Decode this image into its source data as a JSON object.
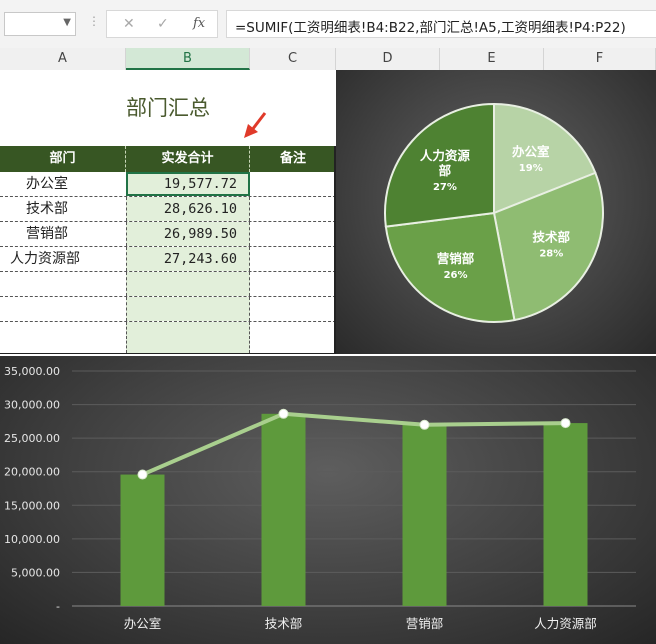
{
  "formula_bar": {
    "name_box_value": "",
    "cancel_icon": "✕",
    "enter_icon": "✓",
    "fx_label": "fx",
    "formula": "=SUMIF(工资明细表!B4:B22,部门汇总!A5,工资明细表!P4:P22)"
  },
  "columns": [
    "A",
    "B",
    "C",
    "D",
    "E",
    "F"
  ],
  "sheet": {
    "title": "部门汇总",
    "headers": [
      "部门",
      "实发合计",
      "备注"
    ],
    "rows": [
      {
        "dept": "办公室",
        "amount": "19,577.72",
        "note": ""
      },
      {
        "dept": "技术部",
        "amount": "28,626.10",
        "note": ""
      },
      {
        "dept": "营销部",
        "amount": "26,989.50",
        "note": ""
      },
      {
        "dept": "人力资源部",
        "amount": "27,243.60",
        "note": ""
      },
      {
        "dept": "",
        "amount": "",
        "note": ""
      },
      {
        "dept": "",
        "amount": "",
        "note": ""
      },
      {
        "dept": "",
        "amount": "",
        "note": ""
      }
    ]
  },
  "pie_chart": {
    "type": "pie",
    "slices": [
      {
        "label": "办公室",
        "pct": "19%",
        "value": 19,
        "color": "#b7d3a6"
      },
      {
        "label": "技术部",
        "pct": "28%",
        "value": 28,
        "color": "#8fbc72"
      },
      {
        "label": "营销部",
        "pct": "26%",
        "value": 26,
        "color": "#6aa048"
      },
      {
        "label": "人力资源部",
        "pct": "27%",
        "value": 27,
        "color": "#4e8232"
      }
    ]
  },
  "chart_data": {
    "type": "bar",
    "categories": [
      "办公室",
      "技术部",
      "营销部",
      "人力资源部"
    ],
    "series": [
      {
        "type": "bar",
        "values": [
          19577.72,
          28626.1,
          26989.5,
          27243.6
        ]
      },
      {
        "type": "line",
        "values": [
          19577.72,
          28626.1,
          26989.5,
          27243.6
        ]
      }
    ],
    "ylim": [
      0,
      35000
    ],
    "yticks": [
      "-",
      "5,000.00",
      "10,000.00",
      "15,000.00",
      "20,000.00",
      "25,000.00",
      "30,000.00",
      "35,000.00"
    ],
    "colors": {
      "bar": "#5e9a3c",
      "line": "#a9cf8e",
      "marker": "#ffffff"
    }
  }
}
